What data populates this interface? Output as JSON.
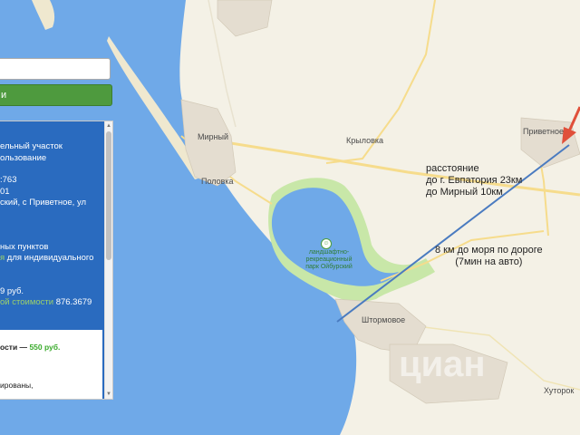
{
  "map": {
    "colors": {
      "sea": "#6fa9e8",
      "land": "#f4f1e6",
      "lake": "#6fa9e8",
      "park": "#c8e7a8",
      "road": "#f6dc8c",
      "arrow": "#e0503a",
      "line": "#4a7bc0"
    },
    "places": {
      "mirny": "Мирный",
      "polovka": "Половка",
      "krylovka": "Крыловка",
      "privetnoe": "Приветное",
      "shtormovoe": "Штормовое",
      "khutorok": "Хуторок"
    },
    "park_label": "ландшафтно-\nрекреационный\nпарк Ойбурский",
    "annotation_1": [
      "расстояние",
      "до г. Евпатория 23км",
      "до Мирный 10км"
    ],
    "annotation_2": [
      "8 км до моря по дороге",
      "(7мин на авто)"
    ],
    "watermark": "циан"
  },
  "panel": {
    "search_value": "",
    "button_label": "и",
    "lines": [
      "ельный участок",
      "ользование",
      ":763",
      "01",
      "ский, с Приветное, ул",
      "ных пунктов",
      "для индивидуального",
      "9 руб.",
      "876.3679"
    ],
    "line_hl_1": "я",
    "line_hl_2": "ой стоимости",
    "white": {
      "l1a": "ости —",
      "l1b": "550 руб.",
      "l2": "ированы,"
    }
  }
}
